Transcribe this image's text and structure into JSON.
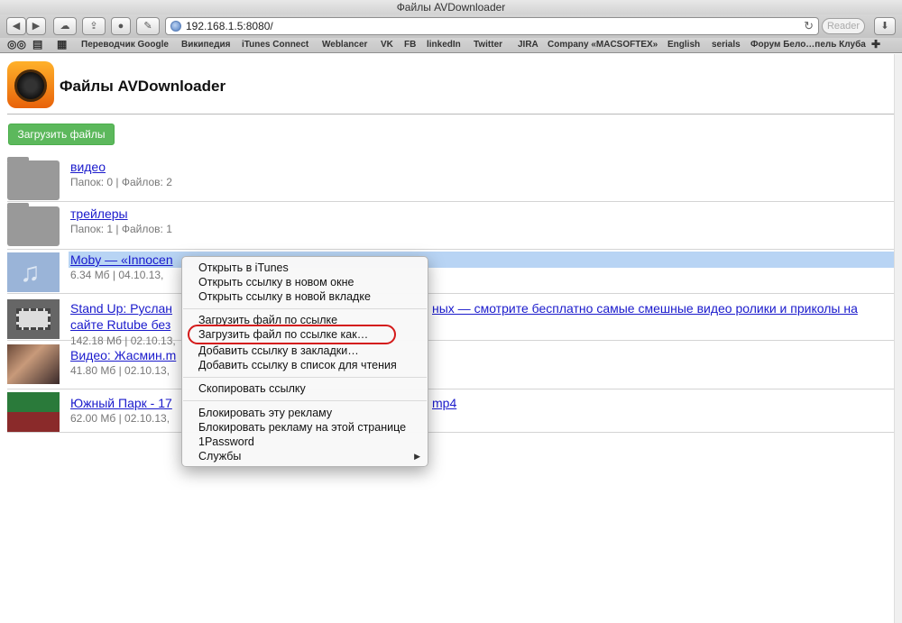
{
  "window": {
    "title": "Файлы AVDownloader"
  },
  "toolbar": {
    "url": "192.168.1.5:8080/",
    "reader_label": "Reader"
  },
  "bookmarks": [
    "Переводчик Google",
    "Википедия",
    "iTunes Connect",
    "Weblancer",
    "VK",
    "FB",
    "linkedIn",
    "Twitter",
    "JIRA",
    "Company «MACSOFTEX»",
    "English",
    "serials",
    "Форум Бело…пель Клуба"
  ],
  "page": {
    "title": "Файлы AVDownloader",
    "upload_label": "Загрузить файлы"
  },
  "items": [
    {
      "title": "видео",
      "meta": "Папок: 0 | Файлов: 2"
    },
    {
      "title": "трейлеры",
      "meta": "Папок: 1 | Файлов: 1"
    },
    {
      "title": "Moby — «Innocen",
      "meta": "6.34 Мб | 04.10.13,"
    },
    {
      "title": "Stand Up: Руслан",
      "title2": "ных — смотрите бесплатно самые смешные видео ролики и приколы на",
      "title3": "сайте Rutube без",
      "meta": "142.18 Мб | 02.10.13,"
    },
    {
      "title": "Видео: Жасмин.m",
      "meta": "41.80 Мб | 02.10.13,"
    },
    {
      "title": "Южный Парк - 17",
      "title_end": "mp4",
      "meta": "62.00 Мб | 02.10.13,"
    }
  ],
  "context_menu": {
    "items": [
      "Открыть в iTunes",
      "Открыть ссылку в новом окне",
      "Открыть ссылку в новой вкладке",
      "Загрузить файл по ссылке",
      "Загрузить файл по ссылке как…",
      "Добавить ссылку в закладки…",
      "Добавить ссылку в список для чтения",
      "Скопировать ссылку",
      "Блокировать эту рекламу",
      "Блокировать рекламу на этой странице",
      "1Password",
      "Службы"
    ],
    "highlight_color": "#d41a1a"
  }
}
